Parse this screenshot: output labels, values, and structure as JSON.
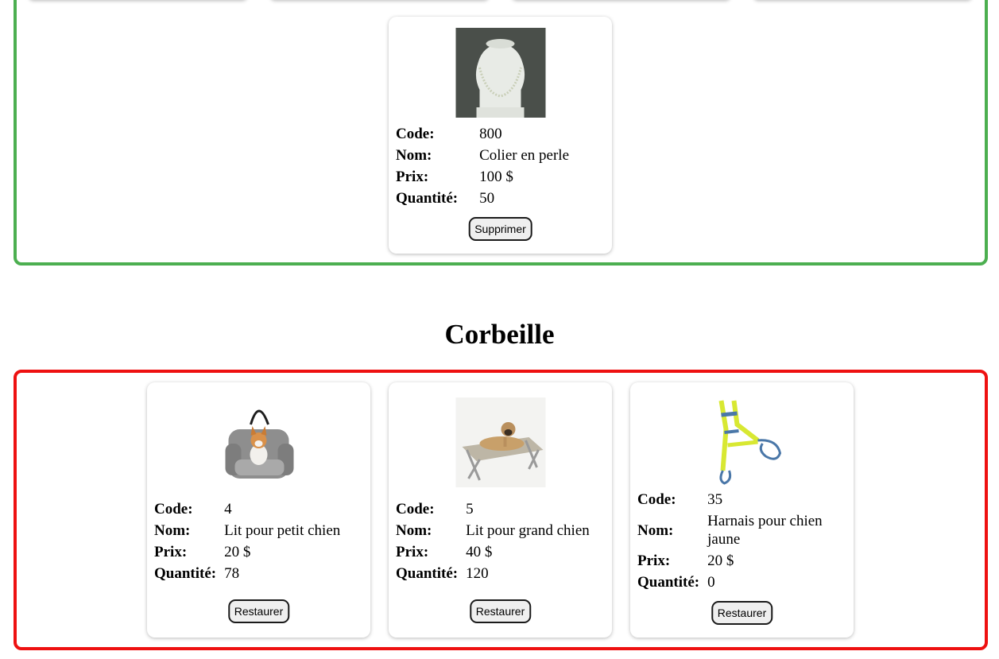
{
  "stock": {
    "products": [
      {
        "code": "800",
        "nom": "Colier en perle",
        "prix": "100 $",
        "quantite": "50",
        "image": "pearl-necklace-image",
        "action": "Supprimer"
      }
    ]
  },
  "trash": {
    "title": "Corbeille",
    "products": [
      {
        "code": "4",
        "nom": "Lit pour petit chien",
        "prix": "20 $",
        "quantite": "78",
        "image": "small-dog-bed-image",
        "action": "Restaurer"
      },
      {
        "code": "5",
        "nom": "Lit pour grand chien",
        "prix": "40 $",
        "quantite": "120",
        "image": "large-dog-cot-image",
        "action": "Restaurer"
      },
      {
        "code": "35",
        "nom": "Harnais pour chien jaune",
        "prix": "20 $",
        "quantite": "0",
        "image": "yellow-dog-harness-image",
        "action": "Restaurer"
      }
    ]
  },
  "labels": {
    "code": "Code:",
    "nom": "Nom:",
    "prix": "Prix:",
    "quantite": "Quantité:"
  },
  "colors": {
    "stock_border": "#4caf50",
    "trash_border": "#ee1111"
  }
}
